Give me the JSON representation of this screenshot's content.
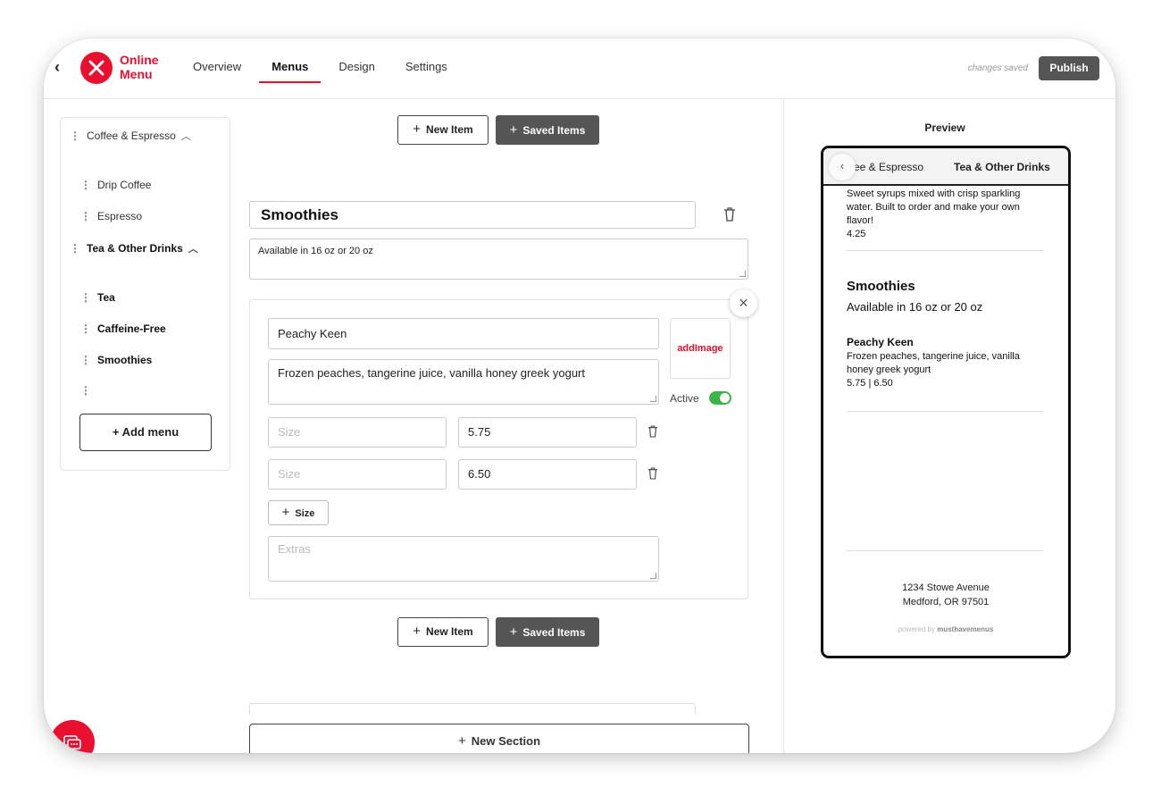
{
  "app": {
    "brand_line1": "Online",
    "brand_line2": "Menu",
    "accent_color": "#e8102e"
  },
  "nav": {
    "tabs": [
      "Overview",
      "Menus",
      "Design",
      "Settings"
    ],
    "active": "Menus"
  },
  "header": {
    "status": "changes saved",
    "publish_label": "Publish"
  },
  "sidebar": {
    "groups": [
      {
        "label": "Coffee & Espresso",
        "expanded": true,
        "items": [
          "Drip Coffee",
          "Espresso"
        ]
      },
      {
        "label": "Tea & Other Drinks",
        "expanded": true,
        "items": [
          "Tea",
          "Caffeine-Free",
          "Smoothies"
        ]
      }
    ],
    "add_menu_label": "+ Add menu"
  },
  "editor": {
    "new_item_label": "New Item",
    "saved_items_label": "Saved Items",
    "section": {
      "title": "Smoothies",
      "description": "Available in 16 oz or 20 oz"
    },
    "item": {
      "name": "Peachy Keen",
      "description": "Frozen peaches, tangerine juice, vanilla honey greek yogurt",
      "add_image_label": "addImage",
      "active_label": "Active",
      "active": true,
      "sizes": [
        {
          "size_placeholder": "Size",
          "price": "5.75"
        },
        {
          "size_placeholder": "Size",
          "price": "6.50"
        }
      ],
      "add_size_label": "Size",
      "extras_placeholder": "Extras"
    },
    "new_section_label": "New Section"
  },
  "preview": {
    "title": "Preview",
    "tabs": [
      "ee & Espresso",
      "Tea & Other Drinks"
    ],
    "prev_item_text": "Sweet syrups mixed with crisp sparkling water. Built to order and make your own flavor!",
    "prev_item_price": "4.25",
    "section_title": "Smoothies",
    "section_desc": "Available in 16 oz or 20 oz",
    "item_name": "Peachy Keen",
    "item_desc": "Frozen peaches, tangerine juice, vanilla honey greek yogurt",
    "item_prices": "5.75 | 6.50",
    "address_line1": "1234 Stowe Avenue",
    "address_line2": "Medford, OR 97501",
    "powered_prefix": "powered by",
    "powered_brand": "musthavemenus"
  }
}
